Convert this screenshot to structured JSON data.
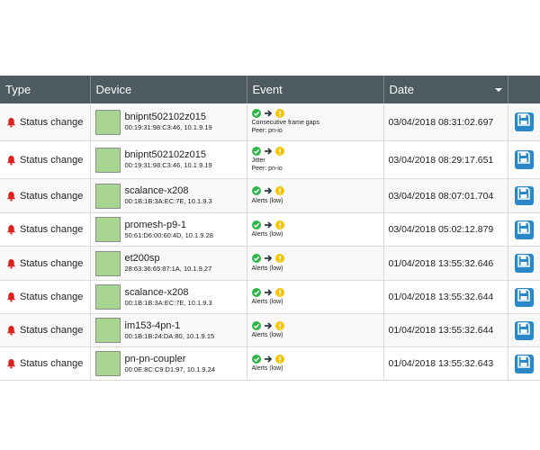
{
  "colors": {
    "header_bg": "#4d5a60",
    "bell": "#e0211b",
    "device_box": "#a8d58f",
    "ok": "#2fb44a",
    "arrow": "#2d3a40",
    "warn": "#f5c400",
    "save": "#2b88c8"
  },
  "columns": {
    "type": "Type",
    "device": "Device",
    "event": "Event",
    "date": "Date"
  },
  "sort": {
    "column": "date",
    "icon": "sort-desc-icon"
  },
  "rows": [
    {
      "type": "Status change",
      "device_name": "bnipnt502102z015",
      "device_addr": "00:19:31:98:C3:46, 10.1.9.19",
      "event_lines": [
        "Consecutive frame gaps",
        "Peer: pn-io"
      ],
      "date": "03/04/2018 08:31:02.697"
    },
    {
      "type": "Status change",
      "device_name": "bnipnt502102z015",
      "device_addr": "00:19:31:98:C3:46, 10.1.9.19",
      "event_lines": [
        "Jitter",
        "Peer: pn-io"
      ],
      "date": "03/04/2018 08:29:17.651"
    },
    {
      "type": "Status change",
      "device_name": "scalance-x208",
      "device_addr": "00:1B:1B:3A:EC:7E, 10.1.9.3",
      "event_lines": [
        "Alerts (low)"
      ],
      "date": "03/04/2018 08:07:01.704"
    },
    {
      "type": "Status change",
      "device_name": "promesh-p9-1",
      "device_addr": "50:61:D6:00:60:4D, 10.1.9.28",
      "event_lines": [
        "Alerts (low)"
      ],
      "date": "03/04/2018 05:02:12.879"
    },
    {
      "type": "Status change",
      "device_name": "et200sp",
      "device_addr": "28:63:36:65:87:1A, 10.1.9.27",
      "event_lines": [
        "Alerts (low)"
      ],
      "date": "01/04/2018 13:55:32.646"
    },
    {
      "type": "Status change",
      "device_name": "scalance-x208",
      "device_addr": "00:1B:1B:3A:EC:7E, 10.1.9.3",
      "event_lines": [
        "Alerts (low)"
      ],
      "date": "01/04/2018 13:55:32.644"
    },
    {
      "type": "Status change",
      "device_name": "im153-4pn-1",
      "device_addr": "00:1B:1B:24:DA:80, 10.1.9.15",
      "event_lines": [
        "Alerts (low)"
      ],
      "date": "01/04/2018 13:55:32.644"
    },
    {
      "type": "Status change",
      "device_name": "pn-pn-coupler",
      "device_addr": "00:0E:8C:C9:D1:97, 10.1.9.24",
      "event_lines": [
        "Alerts (low)"
      ],
      "date": "01/04/2018 13:55:32.643"
    }
  ]
}
